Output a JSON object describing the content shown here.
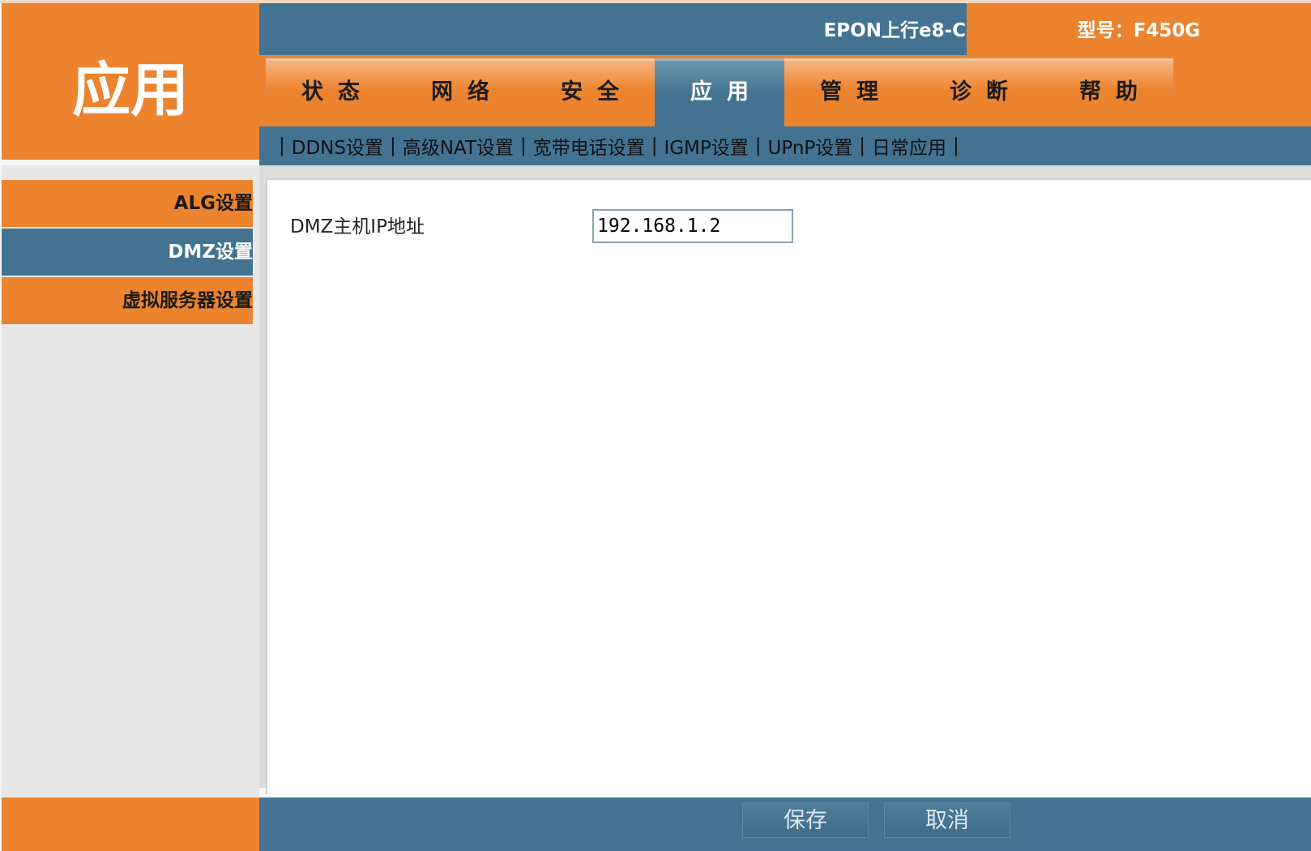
{
  "logo": {
    "title": "应用"
  },
  "header": {
    "product_name": "EPON上行e8-C",
    "model_label": "型号：F450G"
  },
  "nav": {
    "tabs": [
      {
        "label": "状态",
        "active": false
      },
      {
        "label": "网络",
        "active": false
      },
      {
        "label": "安全",
        "active": false
      },
      {
        "label": "应用",
        "active": true
      },
      {
        "label": "管理",
        "active": false
      },
      {
        "label": "诊断",
        "active": false
      },
      {
        "label": "帮助",
        "active": false
      }
    ]
  },
  "subnav": {
    "separator": "|",
    "items": [
      "DDNS设置",
      "高级NAT设置",
      "宽带电话设置",
      "IGMP设置",
      "UPnP设置",
      "日常应用"
    ]
  },
  "sidebar": {
    "items": [
      {
        "label": "ALG设置",
        "active": false
      },
      {
        "label": "DMZ设置",
        "active": true
      },
      {
        "label": "虚拟服务器设置",
        "active": false
      }
    ]
  },
  "form": {
    "dmz_label": "DMZ主机IP地址",
    "dmz_value": "192.168.1.2"
  },
  "footer": {
    "save_label": "保存",
    "cancel_label": "取消"
  },
  "colors": {
    "orange": "#ec842f",
    "blue": "#437391"
  }
}
